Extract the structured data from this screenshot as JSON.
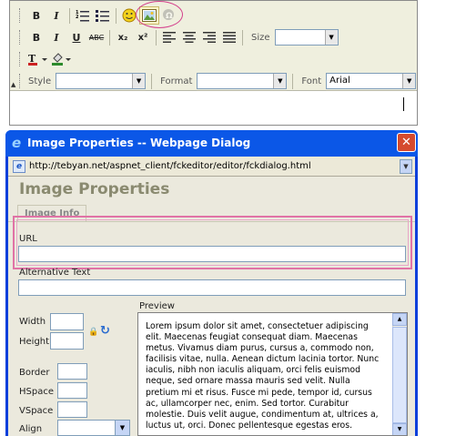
{
  "editor": {
    "row1": {
      "bold": "B",
      "italic": "I"
    },
    "row2": {
      "bold": "B",
      "italic": "I",
      "underline": "U",
      "strike": "ABC",
      "subscript": "x₂",
      "superscript": "x²",
      "size_label": "Size",
      "size_value": ""
    },
    "row3": {
      "style_label": "Style",
      "style_value": "",
      "format_label": "Format",
      "format_value": "",
      "font_label": "Font",
      "font_value": "Arial"
    }
  },
  "dialog": {
    "title": "Image Properties -- Webpage Dialog",
    "close_glyph": "✕",
    "address": "http://tebyan.net/aspnet_client/fckeditor/editor/fckdialog.html",
    "heading": "Image Properties",
    "tab": "Image Info",
    "url_label": "URL",
    "url_value": "",
    "alt_label": "Alternative Text",
    "alt_value": "",
    "preview_label": "Preview",
    "width_label": "Width",
    "height_label": "Height",
    "border_label": "Border",
    "hspace_label": "HSpace",
    "vspace_label": "VSpace",
    "align_label": "Align",
    "align_value": "",
    "preview_text": "Lorem ipsum dolor sit amet, consectetuer adipiscing elit. Maecenas feugiat consequat diam. Maecenas metus. Vivamus diam purus, cursus a, commodo non, facilisis vitae, nulla. Aenean dictum lacinia tortor. Nunc iaculis, nibh non iaculis aliquam, orci felis euismod neque, sed ornare massa mauris sed velit. Nulla pretium mi et risus. Fusce mi pede, tempor id, cursus ac, ullamcorper nec, enim. Sed tortor. Curabitur molestie. Duis velit augue, condimentum at, ultrices a, luctus ut, orci. Donec pellentesque egestas eros."
  },
  "icons": [
    "bold-icon",
    "italic-icon",
    "ordered-list-icon",
    "unordered-list-icon",
    "smiley-icon",
    "image-icon",
    "special-char-icon",
    "text-color-icon",
    "background-color-icon",
    "lock-icon",
    "reset-size-icon",
    "ie-icon",
    "close-icon"
  ],
  "colors": {
    "highlight_ring": "#d4408c",
    "titlebar": "#0b57e7",
    "toolbar_bg": "#efefde"
  }
}
